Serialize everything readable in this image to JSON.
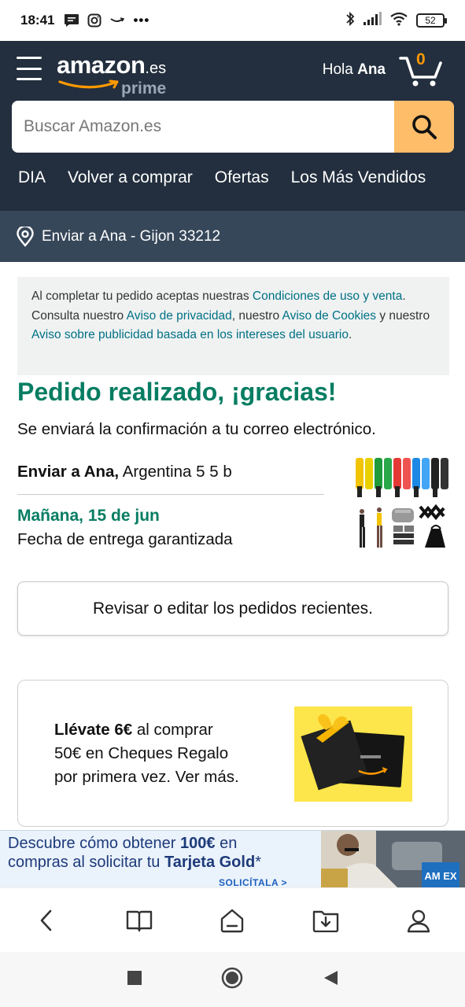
{
  "status_bar": {
    "time": "18:41",
    "battery": "52",
    "more": "•••"
  },
  "header": {
    "logo_word": "amazon",
    "logo_tld": ".es",
    "logo_sub": "prime",
    "greeting_prefix": "Hola",
    "greeting_name": "Ana",
    "cart_count": "0"
  },
  "search": {
    "placeholder": "Buscar Amazon.es"
  },
  "nav_links": [
    {
      "label": "DIA"
    },
    {
      "label": "Volver a comprar"
    },
    {
      "label": "Ofertas"
    },
    {
      "label": "Los Más Vendidos"
    }
  ],
  "delivery_bar": {
    "text": "Enviar a Ana - Gijon 33212"
  },
  "notice": {
    "t1": "Al completar tu pedido aceptas nuestras ",
    "l1": "Condiciones de uso y venta",
    "t2": ". Consulta nuestro ",
    "l2": "Aviso de privacidad",
    "t3": ", nuestro ",
    "l3": "Aviso de Cookies",
    "t4": " y nuestro ",
    "l4": "Aviso sobre publicidad basada en los intereses del usuario",
    "t5": "."
  },
  "order": {
    "title": "Pedido realizado, ¡gracias!",
    "subtitle": "Se enviará la confirmación a tu correo electrónico.",
    "ship_label": "Enviar a Ana,",
    "ship_address": " Argentina 5 5 b",
    "delivery_date": "Mañana, 15 de jun",
    "delivery_note": "Fecha de entrega garantizada"
  },
  "review_button": "Revisar o editar los pedidos recientes.",
  "promo": {
    "bold": "Llévate 6€",
    "line1": " al comprar",
    "line2": "50€ en Cheques Regalo",
    "line3": "por primera vez. Ver más."
  },
  "banner": {
    "line1_a": "Descubre cómo obtener ",
    "line1_b": "100€",
    "line1_c": " en",
    "line2_a": "compras al solicitar tu ",
    "line2_b": "Tarjeta Gold",
    "line2_c": "*",
    "cta": "SOLICÍTALA >",
    "card_text": "AM EX"
  },
  "colors": {
    "header_bg": "#232f3e",
    "subheader_bg": "#37475a",
    "search_button": "#febd69",
    "success_green": "#067d62",
    "link": "#007185",
    "cart_count": "#ff9900"
  },
  "icons": {
    "menu": "hamburger-menu-icon",
    "cart": "cart-icon",
    "search": "search-icon",
    "location": "location-pin-icon",
    "back": "back-arrow-icon",
    "reader": "book-icon",
    "home": "home-icon",
    "downloads": "download-icon",
    "account": "account-icon"
  }
}
